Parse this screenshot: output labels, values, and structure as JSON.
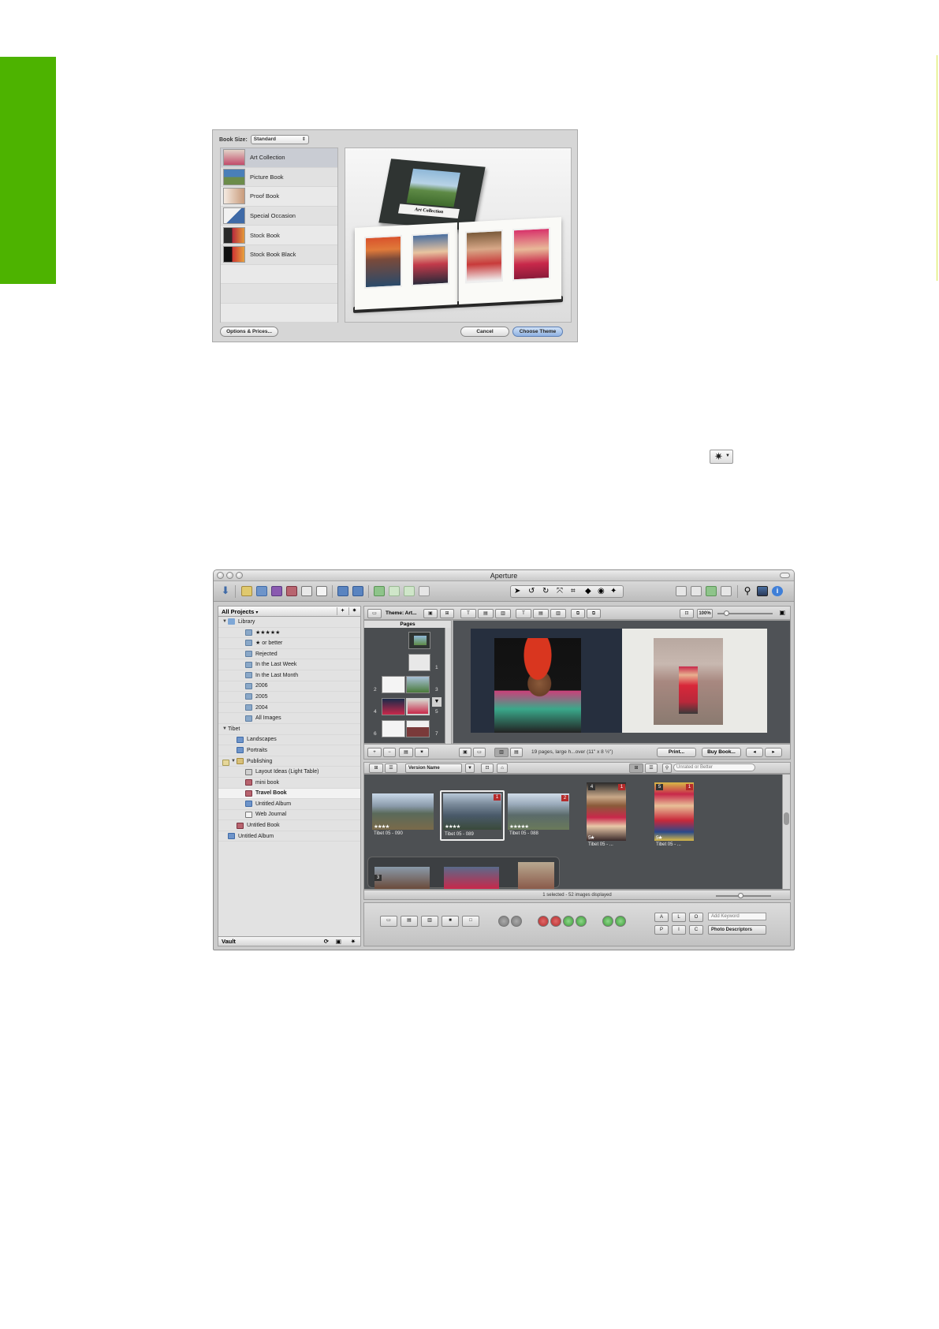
{
  "book_dialog": {
    "size_label": "Book Size:",
    "size_value": "Standard",
    "themes": [
      {
        "label": "Art Collection",
        "selected": true
      },
      {
        "label": "Picture Book",
        "selected": false
      },
      {
        "label": "Proof Book",
        "selected": false
      },
      {
        "label": "Special Occasion",
        "selected": false
      },
      {
        "label": "Stock Book",
        "selected": false
      },
      {
        "label": "Stock Book Black",
        "selected": false
      }
    ],
    "cover_label": "Art Collection",
    "options_button": "Options & Prices...",
    "cancel_button": "Cancel",
    "choose_button": "Choose Theme"
  },
  "gear_icon_glyph": "✷",
  "aperture": {
    "window_title": "Aperture",
    "projects_header": "All Projects",
    "projects_add": "+",
    "projects_action": "✷",
    "tree": [
      {
        "label": "Library",
        "icon": "lib",
        "level": 0,
        "tri": "▼"
      },
      {
        "label": "★★★★★",
        "icon": "smart",
        "level": 2,
        "tri": ""
      },
      {
        "label": "★ or better",
        "icon": "smart",
        "level": 2,
        "tri": ""
      },
      {
        "label": "Rejected",
        "icon": "smart",
        "level": 2,
        "tri": ""
      },
      {
        "label": "In the Last Week",
        "icon": "smart",
        "level": 2,
        "tri": ""
      },
      {
        "label": "In the Last Month",
        "icon": "smart",
        "level": 2,
        "tri": ""
      },
      {
        "label": "2006",
        "icon": "smart",
        "level": 2,
        "tri": ""
      },
      {
        "label": "2005",
        "icon": "smart",
        "level": 2,
        "tri": ""
      },
      {
        "label": "2004",
        "icon": "smart",
        "level": 2,
        "tri": ""
      },
      {
        "label": "All Images",
        "icon": "smart",
        "level": 2,
        "tri": ""
      },
      {
        "label": "Tibet",
        "icon": "proj",
        "level": 0,
        "tri": "▼"
      },
      {
        "label": "Landscapes",
        "icon": "album",
        "level": 1,
        "tri": ""
      },
      {
        "label": "Portraits",
        "icon": "album",
        "level": 1,
        "tri": ""
      },
      {
        "label": "Publishing",
        "icon": "folder",
        "level": 1,
        "tri": "▼"
      },
      {
        "label": "Layout Ideas (Light Table)",
        "icon": "light",
        "level": 2,
        "tri": ""
      },
      {
        "label": "mini book",
        "icon": "book",
        "level": 2,
        "tri": ""
      },
      {
        "label": "Travel Book",
        "icon": "book",
        "level": 2,
        "tri": "",
        "selected": true
      },
      {
        "label": "Untitled Album",
        "icon": "album",
        "level": 2,
        "tri": ""
      },
      {
        "label": "Web Journal",
        "icon": "web",
        "level": 2,
        "tri": ""
      },
      {
        "label": "Untitled Book",
        "icon": "book",
        "level": 1,
        "tri": ""
      },
      {
        "label": "Untitled Album",
        "icon": "album",
        "level": 0,
        "tri": ""
      }
    ],
    "vault_label": "Vault",
    "theme_label": "Theme: Art...",
    "zoom_label": "100%",
    "pages_header": "Pages",
    "page_numbers": [
      "1",
      "2",
      "3",
      "4",
      "5",
      "6",
      "7"
    ],
    "book_status": "19 pages, large h...over (11\" x 8 ½\")",
    "print_button": "Print...",
    "buy_button": "Buy Book...",
    "sort_label": "Version Name",
    "filter_placeholder": "Unrated or Better",
    "photos": [
      {
        "caption": "Tibet 05 - 090",
        "stars": "★★★★",
        "badge": ""
      },
      {
        "caption": "Tibet 05 - 089",
        "stars": "★★★★",
        "badge": "1"
      },
      {
        "caption": "Tibet 05 - 088",
        "stars": "★★★★★",
        "badge": "2"
      },
      {
        "caption": "Tibet 05 - ...",
        "stars": "5★",
        "badge": "1"
      },
      {
        "caption": "Tibet 05 - ...",
        "stars": "5★",
        "badge": "1"
      }
    ],
    "stack_badges": [
      "4",
      "5"
    ],
    "stack_count": "3",
    "browser_status": "1 selected - 52 images displayed",
    "keyword_placeholder": "Add Keyword",
    "keyword_set": "Photo Descriptors",
    "kw_buttons": [
      "A",
      "L",
      "O",
      "P",
      "I",
      "C"
    ],
    "colors": {
      "green_accent": "#4db300",
      "badge_red": "#b52b2b"
    }
  }
}
